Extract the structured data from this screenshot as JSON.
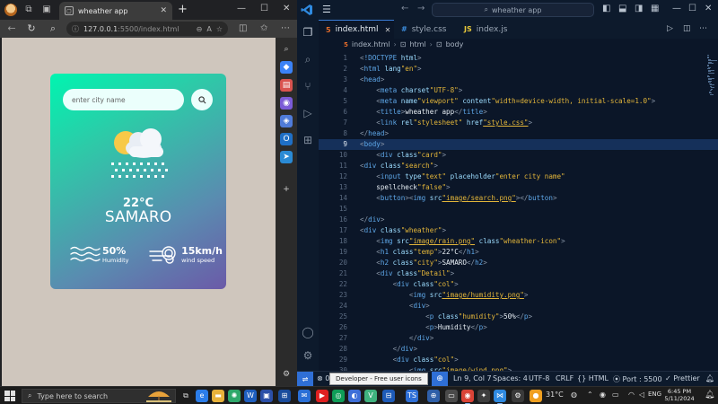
{
  "browser": {
    "tab_title": "wheather app",
    "url_host": "127.0.0.1",
    "url_path": ":5500/index.html",
    "new_tab_symbol": "+",
    "close_tab_symbol": "✕"
  },
  "weather_app": {
    "search_placeholder": "enter city name",
    "temp": "22°C",
    "city": "SAMARO",
    "humidity_value": "50%",
    "humidity_label": "Humidity",
    "wind_value": "15km/h",
    "wind_label": "wind speed"
  },
  "vscode": {
    "command_center": "wheather app",
    "tabs": [
      {
        "label": "index.html",
        "icon": "html-file-icon",
        "active": true
      },
      {
        "label": "style.css",
        "icon": "css-file-icon",
        "active": false
      },
      {
        "label": "index.js",
        "icon": "js-file-icon",
        "active": false
      }
    ],
    "breadcrumb": [
      "index.html",
      "html",
      "body"
    ],
    "current_line": 9,
    "code_lines": [
      "<!DOCTYPE html>",
      "<html lang=\"en\">",
      "<head>",
      "    <meta charset=\"UTF-8\">",
      "    <meta name=\"viewport\" content=\"width=device-width, initial-scale=1.0\">",
      "    <title>wheather app</title>",
      "    <link rel=\"stylesheet\" href=\"style.css\">",
      "</head>",
      "<body>",
      "    <div class=\"card\">",
      "<div class=\"search\">",
      "    <input type=\"text\" placeholder=\"enter city name\"",
      "    spellcheck=\"false\">",
      "    <button><img src=\"image/search.png\"></button>",
      "",
      "</div>",
      "<div class=\"wheather\">",
      "    <img src=\"image/rain.png\" class=\"wheather-icon\">",
      "    <h1 class=\"temp\">22°C</h1>",
      "    <h2 class=\"city\">SAMARO</h2>",
      "    <div class=\"Detail\">",
      "        <div class=\"col\">",
      "            <img src=\"image/humidity.png\">",
      "            <div>",
      "                <p class=\"humidity\">50%</p>",
      "                <p>Humidity</p>",
      "            </div>",
      "        </div>",
      "        <div class=\"col\">",
      "            <img src=\"image/wind.png\">"
    ],
    "status": {
      "errors": "0",
      "tooltip": "Developer - Free user icons",
      "position": "Ln 9, Col 7",
      "spaces": "Spaces: 4",
      "encoding": "UTF-8",
      "eol": "CRLF",
      "language": "HTML",
      "port": "Port : 5500",
      "formatter": "Prettier"
    }
  },
  "taskbar": {
    "search_placeholder": "Type here to search",
    "weather": "31°C",
    "language": "ENG",
    "time": "6:45 PM",
    "date": "5/11/2024"
  },
  "colors": {
    "card_top": "#00f5b0",
    "card_bottom": "#6b5aa8",
    "vscode_bg": "#0b1628",
    "accent": "#2f6fd6"
  }
}
